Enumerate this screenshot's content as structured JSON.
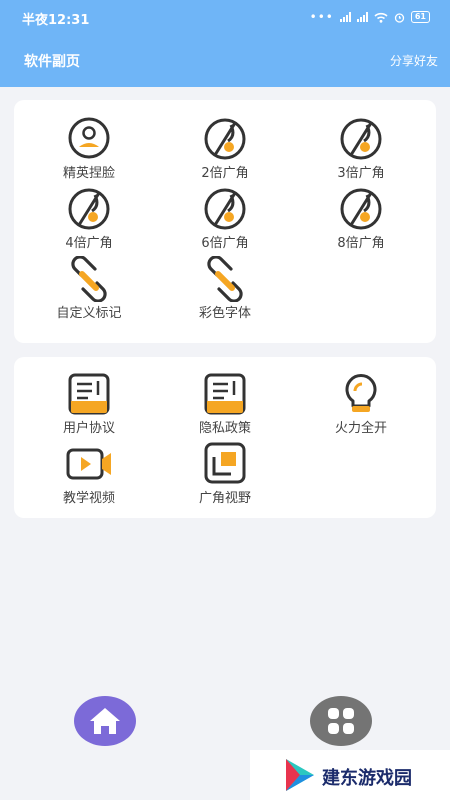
{
  "status_bar": {
    "time": "半夜12:31",
    "battery": "61"
  },
  "header": {
    "title": "软件副页",
    "share_label": "分享好友"
  },
  "grid1": {
    "items": [
      {
        "label": "精英捏脸",
        "icon": "face-avatar-icon"
      },
      {
        "label": "2倍广角",
        "icon": "aperture-icon"
      },
      {
        "label": "3倍广角",
        "icon": "aperture-icon"
      },
      {
        "label": "4倍广角",
        "icon": "aperture-icon"
      },
      {
        "label": "6倍广角",
        "icon": "aperture-icon"
      },
      {
        "label": "8倍广角",
        "icon": "aperture-icon"
      },
      {
        "label": "自定义标记",
        "icon": "link-icon"
      },
      {
        "label": "彩色字体",
        "icon": "link-icon"
      }
    ]
  },
  "grid2": {
    "items": [
      {
        "label": "用户协议",
        "icon": "document-icon"
      },
      {
        "label": "隐私政策",
        "icon": "document-icon"
      },
      {
        "label": "火力全开",
        "icon": "lightbulb-icon"
      },
      {
        "label": "教学视频",
        "icon": "video-camera-icon"
      },
      {
        "label": "广角视野",
        "icon": "crop-icon"
      }
    ]
  },
  "bottom_nav": {
    "home_icon": "home-icon",
    "apps_icon": "grid-icon"
  },
  "watermark": {
    "text": "建东游戏园"
  },
  "colors": {
    "header": "#6fb5f7",
    "accent": "#f5a623",
    "icon_stroke": "#333333",
    "home_button": "#7c6ad8",
    "apps_button": "#747474"
  }
}
